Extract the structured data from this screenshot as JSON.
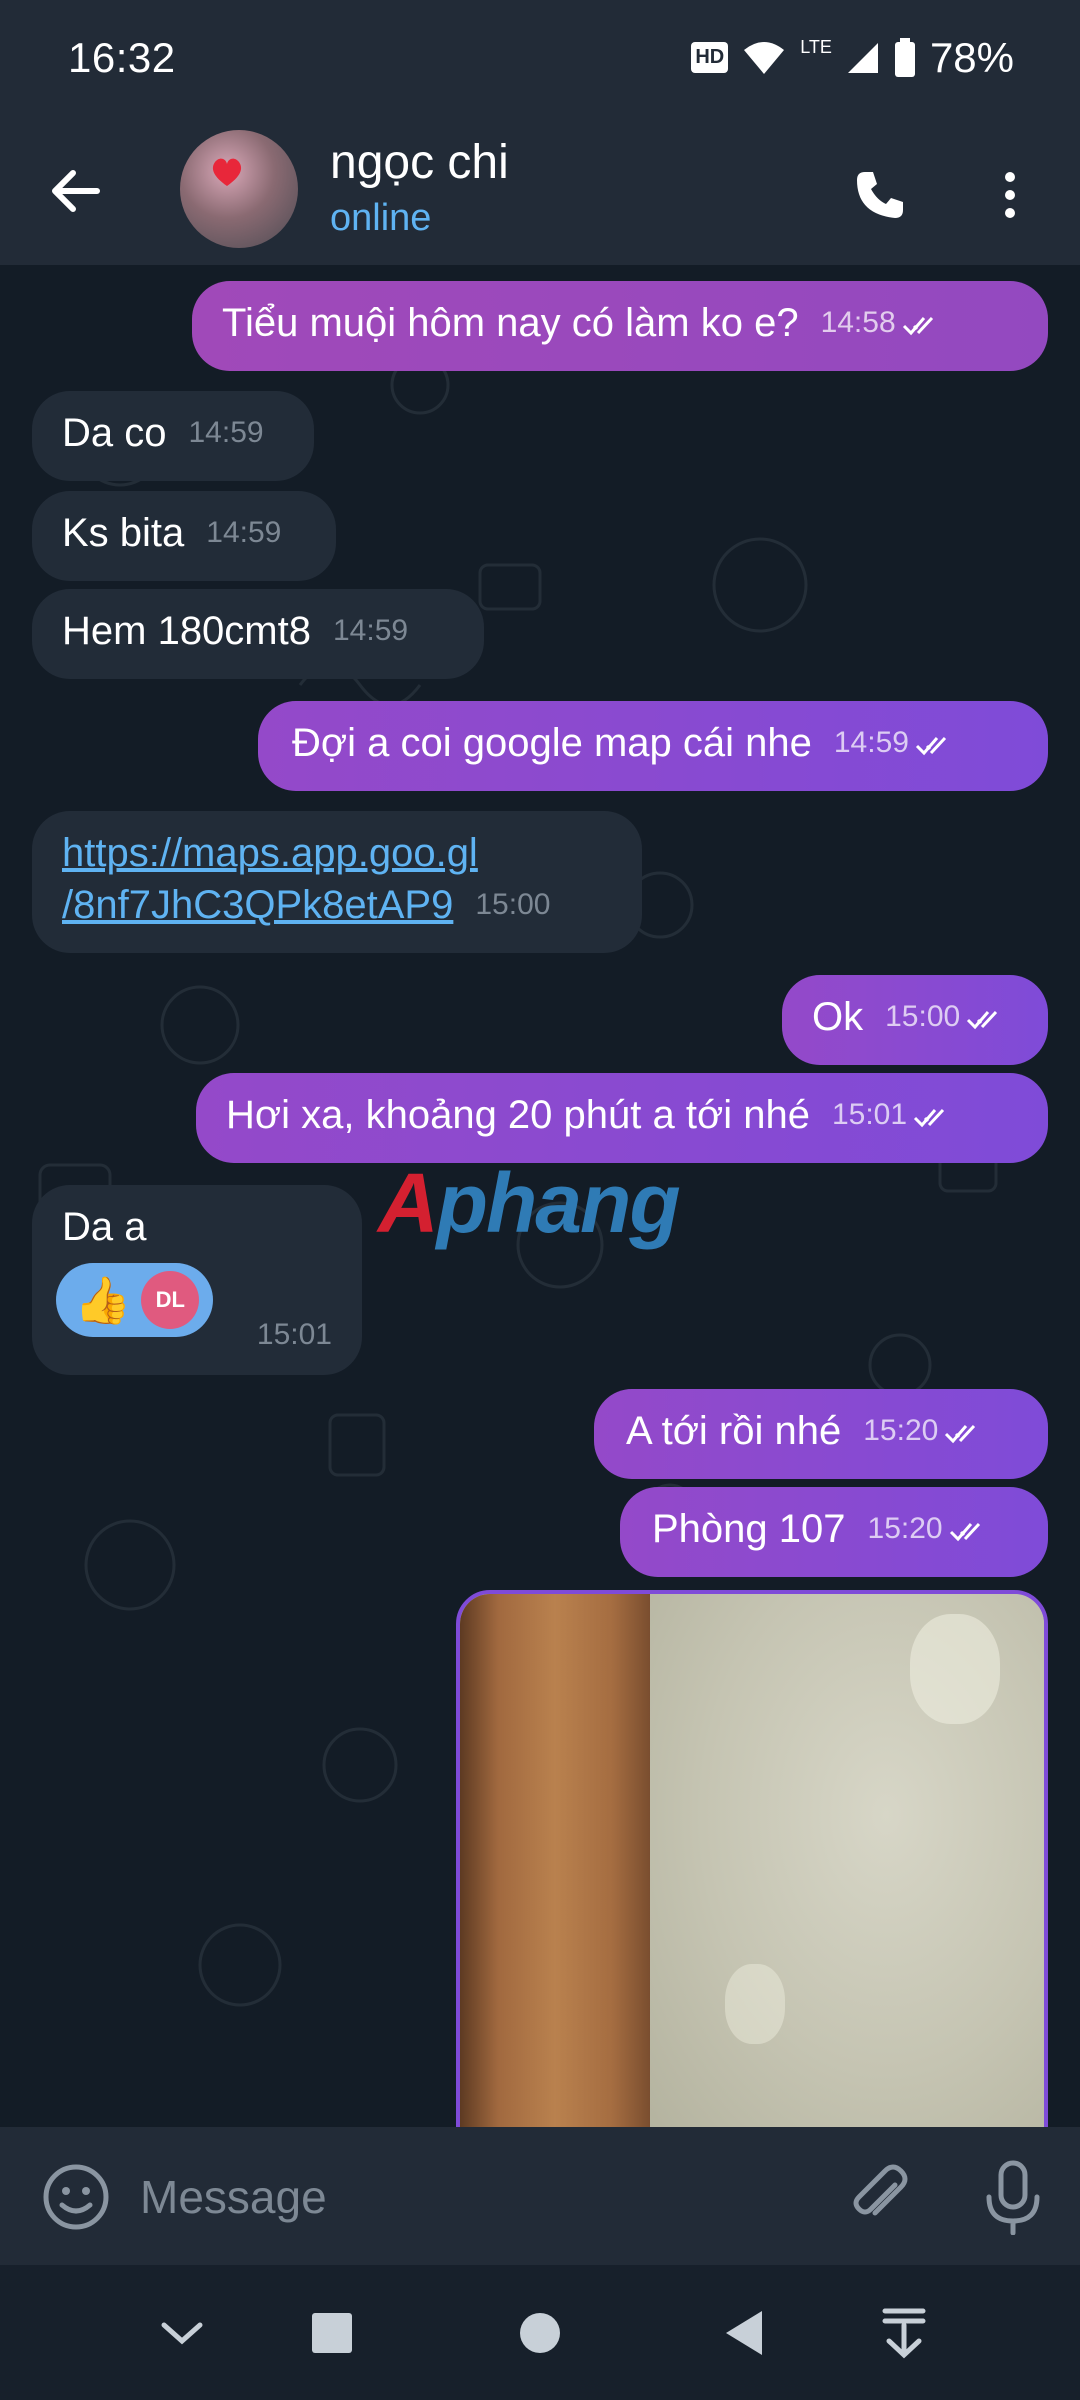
{
  "status_bar": {
    "time": "16:32",
    "hd": "HD",
    "network": "LTE",
    "battery": "78%",
    "icons": [
      "hd-icon",
      "wifi-icon",
      "lte-icon",
      "signal-icon",
      "battery-icon"
    ]
  },
  "header": {
    "contact_name": "ngọc chi",
    "status": "online",
    "icons": [
      "back-arrow-icon",
      "phone-icon",
      "more-vert-icon"
    ]
  },
  "messages": [
    {
      "direction": "out",
      "text": "Tiểu muội hôm nay có làm ko e?",
      "time": "14:58",
      "read": true
    },
    {
      "direction": "in",
      "text": "Da co",
      "time": "14:59"
    },
    {
      "direction": "in",
      "text": "Ks bita",
      "time": "14:59"
    },
    {
      "direction": "in",
      "text": "Hem 180cmt8",
      "time": "14:59"
    },
    {
      "direction": "out",
      "text": "Đợi a coi google map cái nhe",
      "time": "14:59",
      "read": true
    },
    {
      "direction": "in",
      "link_line1": "https://maps.app.goo.gl",
      "link_line2": "/8nf7JhC3QPk8etAP9",
      "time": "15:00"
    },
    {
      "direction": "out",
      "text": "Ok",
      "time": "15:00",
      "read": true
    },
    {
      "direction": "out",
      "text": "Hơi xa, khoảng 20 phút a tới nhé",
      "time": "15:01",
      "read": true
    },
    {
      "direction": "in",
      "text": "Da a",
      "time": "15:01",
      "reaction": {
        "emoji": "👍",
        "initials": "DL"
      }
    },
    {
      "direction": "out",
      "text": "A tới rồi nhé",
      "time": "15:20",
      "read": true
    },
    {
      "direction": "out",
      "text": "Phòng 107",
      "time": "15:20",
      "read": true
    }
  ],
  "watermark": {
    "first": "A",
    "rest": "phang"
  },
  "composer": {
    "placeholder": "Message",
    "icons": [
      "emoji-icon",
      "attach-icon",
      "mic-icon"
    ]
  },
  "nav_bar": {
    "icons": [
      "chevron-down-icon",
      "recents-icon",
      "home-icon",
      "back-icon",
      "notifications-pull-icon"
    ]
  },
  "colors": {
    "outgoing_bubble": "#8a4ad0",
    "incoming_bubble": "#222c38",
    "accent_blue": "#5fb3f2",
    "header_bg": "#222b37",
    "chat_bg": "#131c26"
  }
}
